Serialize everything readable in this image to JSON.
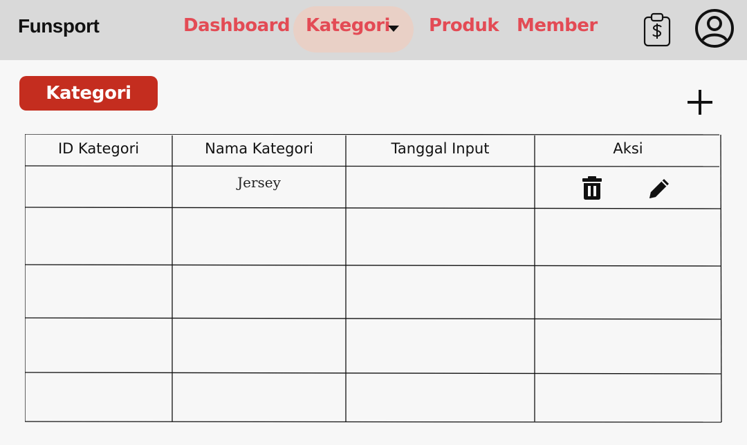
{
  "app": {
    "brand": "Funsport"
  },
  "nav": {
    "items": [
      {
        "label": "Dashboard"
      },
      {
        "label": "Kategori"
      },
      {
        "label": "Produk"
      },
      {
        "label": "Member"
      }
    ]
  },
  "section": {
    "title": "Kategori"
  },
  "table": {
    "columns": [
      "ID Kategori",
      "Nama Kategori",
      "Tanggal Input",
      "Aksi"
    ],
    "rows": [
      {
        "id": "",
        "nama": "Jersey",
        "tanggal": "",
        "actions": [
          "trash-icon",
          "pencil-icon"
        ]
      },
      {
        "id": "",
        "nama": "",
        "tanggal": ""
      },
      {
        "id": "",
        "nama": "",
        "tanggal": ""
      },
      {
        "id": "",
        "nama": "",
        "tanggal": ""
      },
      {
        "id": "",
        "nama": "",
        "tanggal": ""
      }
    ]
  },
  "colors": {
    "topbar": "#d9d9d9",
    "nav_text": "#e34b55",
    "active_pill": "#e9d0c6",
    "section_badge": "#c42d1f",
    "background": "#f7f7f7"
  }
}
